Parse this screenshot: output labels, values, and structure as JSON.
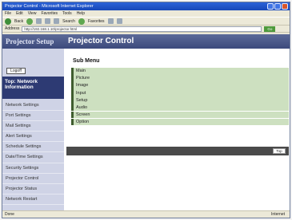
{
  "window": {
    "title": "Projector Control - Microsoft Internet Explorer"
  },
  "menu": {
    "items": [
      "File",
      "Edit",
      "View",
      "Favorites",
      "Tools",
      "Help"
    ]
  },
  "toolbar": {
    "back": "Back",
    "search": "Search",
    "favorites": "Favorites"
  },
  "address": {
    "label": "Address",
    "value": "http://192.168.1.10/projector.html",
    "go": "Go"
  },
  "sidebar": {
    "brand": "Projector Setup",
    "logoff": "Logoff",
    "top_nav": "Top: Network Information",
    "items": [
      "Network Settings",
      "Port Settings",
      "Mail Settings",
      "Alert Settings",
      "Schedule Settings",
      "Date/Time Settings",
      "Security Settings",
      "Projector Control",
      "Projector Status",
      "Network Restart"
    ]
  },
  "main": {
    "title": "Projector Control",
    "submenu_title": "Sub Menu",
    "submenu": [
      "Main",
      "Picture",
      "Image",
      "Input",
      "Setup",
      "Audio",
      "Screen",
      "Option"
    ],
    "top_button": "Top"
  },
  "status": {
    "left": "Done",
    "right": "Internet"
  }
}
